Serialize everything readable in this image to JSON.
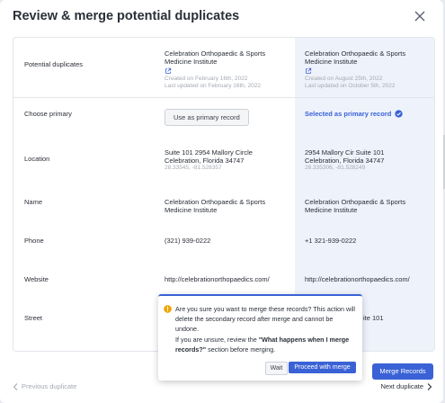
{
  "dialog": {
    "title": "Review & merge potential duplicates"
  },
  "rows": {
    "potential_duplicates": {
      "label": "Potential duplicates",
      "primary": {
        "name": "Celebration Orthopaedic & Sports Medicine Institute",
        "created": "Created on February 16th, 2022",
        "updated": "Last updated on February 16th, 2022"
      },
      "secondary": {
        "name": "Celebration Orthopaedic & Sports Medicine Institute",
        "created": "Created on August 25th, 2022",
        "updated": "Last updated on October 5th, 2022"
      }
    },
    "choose_primary": {
      "label": "Choose primary",
      "use_button": "Use as primary record",
      "selected_text": "Selected as primary record"
    },
    "location": {
      "label": "Location",
      "primary": {
        "line1": "Suite 101 2954 Mallory Circle",
        "line2": "Celebration, Florida 34747",
        "coords": "28.33545, -81.528357"
      },
      "secondary": {
        "line1": "2954 Mallory Cir Suite 101",
        "line2": "Celebration, Florida 34747",
        "coords": "28.335306, -81.528249"
      }
    },
    "name": {
      "label": "Name",
      "primary": "Celebration Orthopaedic & Sports Medicine Institute",
      "secondary": "Celebration Orthopaedic & Sports Medicine Institute"
    },
    "phone": {
      "label": "Phone",
      "primary": "(321) 939-0222",
      "secondary": "+1 321-939-0222"
    },
    "website": {
      "label": "Website",
      "primary": "http://celebrationorthopaedics.com/",
      "secondary": "http://celebrationorthopaedics.com/"
    },
    "street": {
      "label": "Street",
      "secondary_partial": "ite 101"
    }
  },
  "popover": {
    "text_1": "Are you sure you want to merge these records? This action will delete the secondary record after merge and cannot be undone.",
    "text_2_pre": "If you are unsure, review the ",
    "text_2_bold": "\"What happens when I merge records?\"",
    "text_2_post": " section before merging.",
    "wait": "Wait",
    "proceed": "Proceed with merge"
  },
  "footer": {
    "merge": "Merge Records",
    "previous": "Previous duplicate",
    "next": "Next duplicate"
  },
  "colors": {
    "accent": "#3a62d6",
    "highlight_column": "#eef2fb",
    "warning": "#f0a500"
  }
}
